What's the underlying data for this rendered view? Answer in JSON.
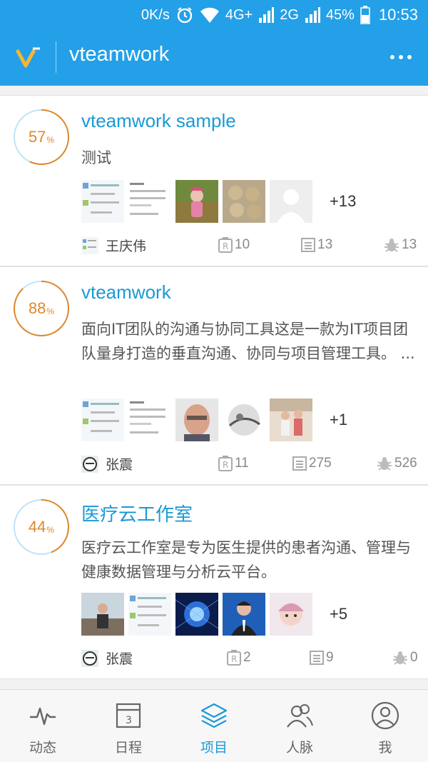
{
  "status_bar": {
    "net_speed": "0K/s",
    "network1": "4G+",
    "network2": "2G",
    "battery": "45%",
    "time": "10:53"
  },
  "app_bar": {
    "title": "vteamwork",
    "logo_icon": "v-logo-icon",
    "menu_icon": "more-dots-icon"
  },
  "projects": [
    {
      "progress": "57",
      "progress_unit": "%",
      "progress_value": 0.57,
      "title": "vteamwork sample",
      "desc": "测试",
      "more_members": "+13",
      "owner": "王庆伟",
      "reports": "10",
      "tasks": "13",
      "bugs": "13"
    },
    {
      "progress": "88",
      "progress_unit": "%",
      "progress_value": 0.88,
      "title": "vteamwork",
      "desc": "面向IT团队的沟通与协同工具这是一款为IT项目团队量身打造的垂直沟通、协同与项目管理工具。 ...",
      "more_members": "+1",
      "owner": "张震",
      "reports": "11",
      "tasks": "275",
      "bugs": "526"
    },
    {
      "progress": "44",
      "progress_unit": "%",
      "progress_value": 0.44,
      "title": "医疗云工作室",
      "desc": "医疗云工作室是专为医生提供的患者沟通、管理与健康数据管理与分析云平台。",
      "more_members": "+5",
      "owner": "张震",
      "reports": "2",
      "tasks": "9",
      "bugs": "0"
    }
  ],
  "tabs": [
    {
      "label": "动态",
      "icon": "activity-pulse-icon"
    },
    {
      "label": "日程",
      "icon": "calendar-icon",
      "day": "3"
    },
    {
      "label": "项目",
      "icon": "layers-icon"
    },
    {
      "label": "人脉",
      "icon": "contacts-icon"
    },
    {
      "label": "我",
      "icon": "profile-icon"
    }
  ],
  "colors": {
    "primary": "#23a0e8",
    "title_blue": "#1a9ad6",
    "progress_orange": "#e0882a",
    "ring_track": "#bfe3f5"
  }
}
